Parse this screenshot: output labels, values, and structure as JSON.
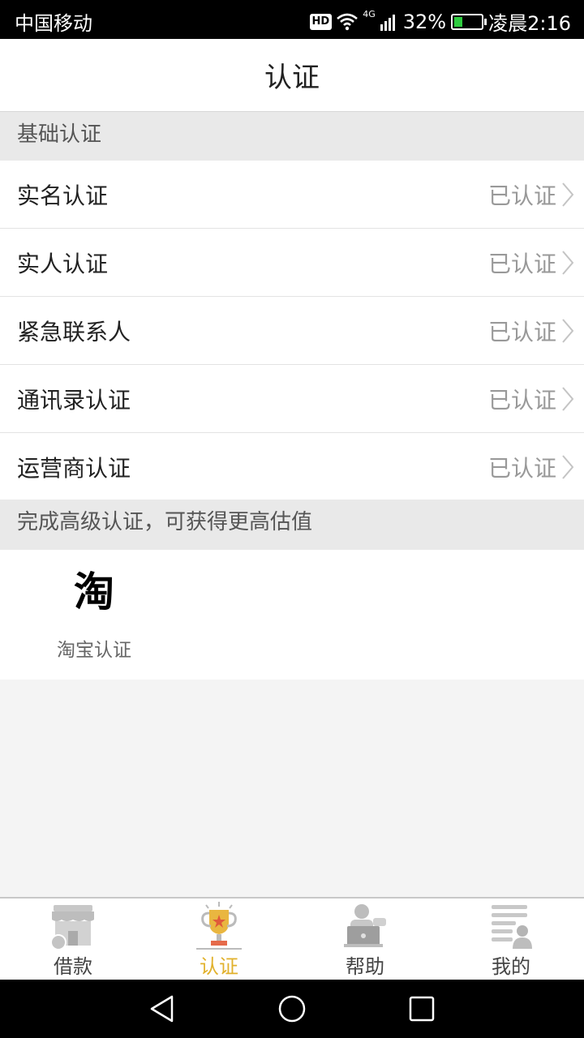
{
  "status_bar": {
    "carrier": "中国移动",
    "hd": "HD",
    "network": "4G",
    "battery": "32%",
    "battery_level": 0.32,
    "time": "凌晨2:16"
  },
  "header": {
    "title": "认证"
  },
  "basic_section": {
    "title": "基础认证",
    "items": [
      {
        "label": "实名认证",
        "status": "已认证"
      },
      {
        "label": "实人认证",
        "status": "已认证"
      },
      {
        "label": "紧急联系人",
        "status": "已认证"
      },
      {
        "label": "通讯录认证",
        "status": "已认证"
      },
      {
        "label": "运营商认证",
        "status": "已认证"
      }
    ]
  },
  "advanced_section": {
    "title": "完成高级认证，可获得更高估值",
    "items": [
      {
        "icon_text": "淘",
        "label": "淘宝认证",
        "icon": "taobao-icon"
      }
    ]
  },
  "tabbar": {
    "tabs": [
      {
        "label": "借款",
        "icon": "shop-icon",
        "active": false
      },
      {
        "label": "认证",
        "icon": "trophy-icon",
        "active": true
      },
      {
        "label": "帮助",
        "icon": "support-icon",
        "active": false
      },
      {
        "label": "我的",
        "icon": "profile-icon",
        "active": false
      }
    ]
  },
  "colors": {
    "accent": "#e1b12c",
    "muted": "#999999",
    "section_bg": "#e9e9e9"
  }
}
